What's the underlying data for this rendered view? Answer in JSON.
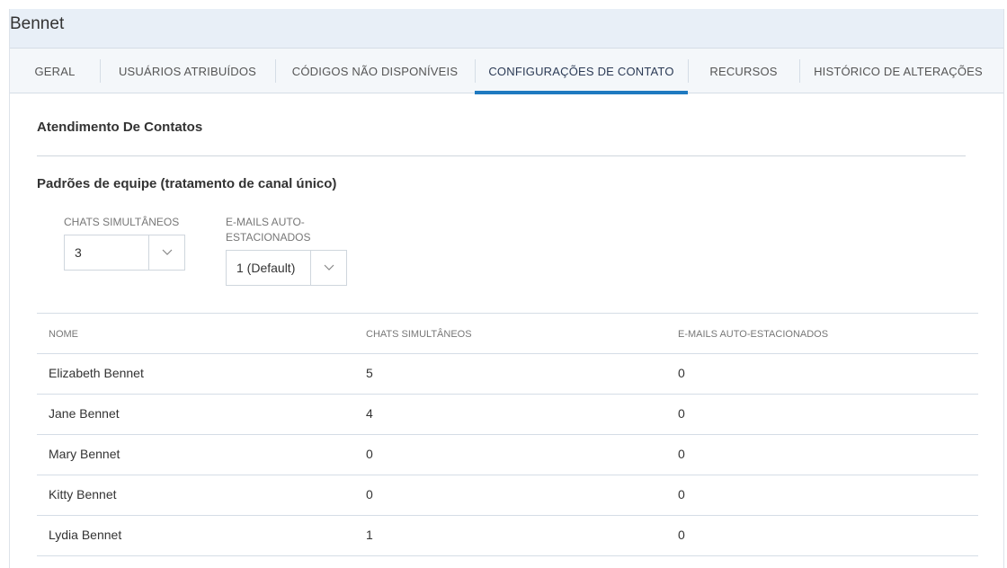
{
  "header": {
    "title": "Bennet"
  },
  "tabs": [
    {
      "label": "GERAL",
      "active": false
    },
    {
      "label": "USUÁRIOS ATRIBUÍDOS",
      "active": false
    },
    {
      "label": "CÓDIGOS NÃO DISPONÍVEIS",
      "active": false
    },
    {
      "label": "CONFIGURAÇÕES DE CONTATO",
      "active": true
    },
    {
      "label": "RECURSOS",
      "active": false
    },
    {
      "label": "HISTÓRICO DE ALTERAÇÕES",
      "active": false
    }
  ],
  "colors": {
    "accent": "#1f7ac0",
    "header_bg": "#e8eff7",
    "tabs_bg": "#f4f7fa"
  },
  "section": {
    "title": "Atendimento De Contatos"
  },
  "team_defaults": {
    "title": "Padrões de equipe (tratamento de canal único)",
    "chats": {
      "label": "CHATS SIMULTÂNEOS",
      "value": "3",
      "icon": "chevron-down-icon"
    },
    "emails": {
      "label_line1": "E-MAILS AUTO-",
      "label_line2": "ESTACIONADOS",
      "value": "1 (Default)",
      "icon": "chevron-down-icon"
    }
  },
  "table": {
    "headers": [
      "NOME",
      "CHATS SIMULTÂNEOS",
      "E-MAILS AUTO-ESTACIONADOS"
    ],
    "rows": [
      [
        "Elizabeth Bennet",
        "5",
        "0"
      ],
      [
        "Jane Bennet",
        "4",
        "0"
      ],
      [
        "Mary Bennet",
        "0",
        "0"
      ],
      [
        "Kitty Bennet",
        "0",
        "0"
      ],
      [
        "Lydia Bennet",
        "1",
        "0"
      ]
    ]
  }
}
